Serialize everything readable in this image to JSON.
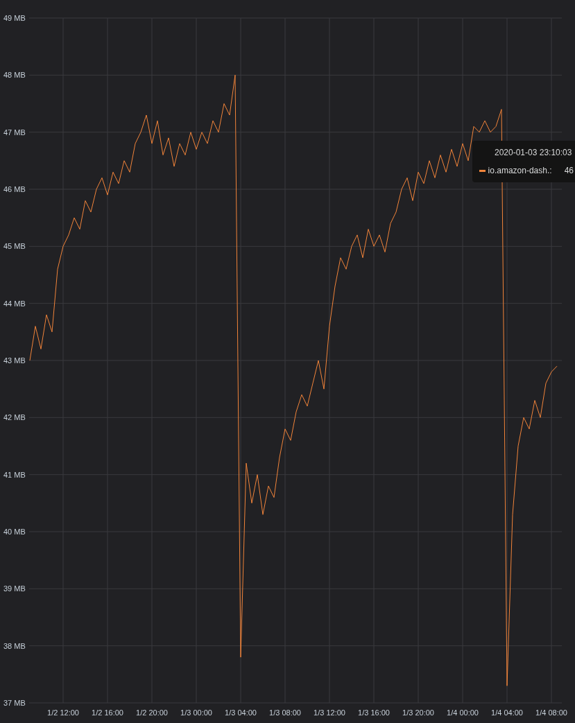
{
  "chart": {
    "chart_data": {
      "type": "line",
      "grid": true,
      "categories": [
        null,
        null,
        null,
        null,
        null,
        null,
        "1/2 12:00",
        null,
        null,
        null,
        null,
        null,
        null,
        null,
        "1/2 16:00",
        null,
        null,
        null,
        null,
        null,
        null,
        null,
        "1/2 20:00",
        null,
        null,
        null,
        null,
        null,
        null,
        null,
        "1/3 00:00",
        null,
        null,
        null,
        null,
        null,
        null,
        null,
        "1/3 04:00",
        null,
        null,
        null,
        null,
        null,
        null,
        null,
        "1/3 08:00",
        null,
        null,
        null,
        null,
        null,
        null,
        null,
        "1/3 12:00",
        null,
        null,
        null,
        null,
        null,
        null,
        null,
        "1/3 16:00",
        null,
        null,
        null,
        null,
        null,
        null,
        null,
        "1/3 20:00",
        null,
        null,
        null,
        null,
        null,
        null,
        null,
        "1/4 00:00",
        null,
        null,
        null,
        null,
        null,
        null,
        null,
        "1/4 04:00",
        null,
        null,
        null,
        null,
        null,
        null,
        null,
        "1/4 08:00",
        null
      ],
      "series": [
        {
          "name": "io.amazon-dash.:",
          "color": "#f2843a",
          "values": [
            43.0,
            43.6,
            43.2,
            43.8,
            43.5,
            44.6,
            45.0,
            45.2,
            45.5,
            45.3,
            45.8,
            45.6,
            46.0,
            46.2,
            45.9,
            46.3,
            46.1,
            46.5,
            46.3,
            46.8,
            47.0,
            47.3,
            46.8,
            47.2,
            46.6,
            46.9,
            46.4,
            46.8,
            46.6,
            47.0,
            46.7,
            47.0,
            46.8,
            47.2,
            47.0,
            47.5,
            47.3,
            48.0,
            37.8,
            41.2,
            40.5,
            41.0,
            40.3,
            40.8,
            40.6,
            41.3,
            41.8,
            41.6,
            42.1,
            42.4,
            42.2,
            42.6,
            43.0,
            42.5,
            43.6,
            44.3,
            44.8,
            44.6,
            45.0,
            45.2,
            44.8,
            45.3,
            45.0,
            45.2,
            44.9,
            45.4,
            45.6,
            46.0,
            46.2,
            45.8,
            46.3,
            46.1,
            46.5,
            46.2,
            46.6,
            46.3,
            46.7,
            46.4,
            46.8,
            46.5,
            47.1,
            47.0,
            47.2,
            47.0,
            47.1,
            47.4,
            37.3,
            40.3,
            41.5,
            42.0,
            41.8,
            42.3,
            42.0,
            42.6,
            42.8,
            42.9
          ]
        }
      ],
      "ylim": [
        37,
        49
      ],
      "yticks": [
        {
          "value": 37,
          "label": "37 MB"
        },
        {
          "value": 38,
          "label": "38 MB"
        },
        {
          "value": 39,
          "label": "39 MB"
        },
        {
          "value": 40,
          "label": "40 MB"
        },
        {
          "value": 41,
          "label": "41 MB"
        },
        {
          "value": 42,
          "label": "42 MB"
        },
        {
          "value": 43,
          "label": "43 MB"
        },
        {
          "value": 44,
          "label": "44 MB"
        },
        {
          "value": 45,
          "label": "45 MB"
        },
        {
          "value": 46,
          "label": "46 MB"
        },
        {
          "value": 47,
          "label": "47 MB"
        },
        {
          "value": 48,
          "label": "48 MB"
        },
        {
          "value": 49,
          "label": "49 MB"
        }
      ]
    }
  },
  "tooltip": {
    "time": "2020-01-03 23:10:03",
    "series": [
      {
        "value": "46",
        "color": "#f2843a"
      }
    ]
  }
}
